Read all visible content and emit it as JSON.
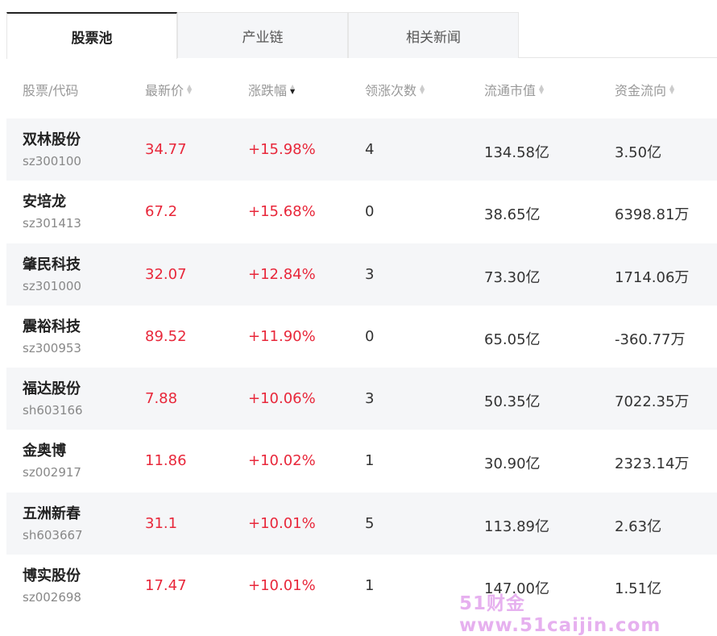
{
  "tabs": [
    {
      "label": "股票池",
      "active": true
    },
    {
      "label": "产业链",
      "active": false
    },
    {
      "label": "相关新闻",
      "active": false
    }
  ],
  "columns": {
    "name": "股票/代码",
    "price": "最新价",
    "change": "涨跌幅",
    "limit_count": "领涨次数",
    "float_cap": "流通市值",
    "fund_flow": "资金流向"
  },
  "sort_column": "change",
  "rows": [
    {
      "name": "双林股份",
      "code": "sz300100",
      "price": "34.77",
      "change": "+15.98%",
      "count": "4",
      "cap": "134.58亿",
      "flow": "3.50亿"
    },
    {
      "name": "安培龙",
      "code": "sz301413",
      "price": "67.2",
      "change": "+15.68%",
      "count": "0",
      "cap": "38.65亿",
      "flow": "6398.81万"
    },
    {
      "name": "肇民科技",
      "code": "sz301000",
      "price": "32.07",
      "change": "+12.84%",
      "count": "3",
      "cap": "73.30亿",
      "flow": "1714.06万"
    },
    {
      "name": "震裕科技",
      "code": "sz300953",
      "price": "89.52",
      "change": "+11.90%",
      "count": "0",
      "cap": "65.05亿",
      "flow": "-360.77万"
    },
    {
      "name": "福达股份",
      "code": "sh603166",
      "price": "7.88",
      "change": "+10.06%",
      "count": "3",
      "cap": "50.35亿",
      "flow": "7022.35万"
    },
    {
      "name": "金奥博",
      "code": "sz002917",
      "price": "11.86",
      "change": "+10.02%",
      "count": "1",
      "cap": "30.90亿",
      "flow": "2323.14万"
    },
    {
      "name": "五洲新春",
      "code": "sh603667",
      "price": "31.1",
      "change": "+10.01%",
      "count": "5",
      "cap": "113.89亿",
      "flow": "2.63亿"
    },
    {
      "name": "博实股份",
      "code": "sz002698",
      "price": "17.47",
      "change": "+10.01%",
      "count": "1",
      "cap": "147.00亿",
      "flow": "1.51亿"
    }
  ],
  "watermark": "51财金www.51caijin.com",
  "colors": {
    "up": "#e8273a",
    "stripe": "#f5f6f8"
  }
}
